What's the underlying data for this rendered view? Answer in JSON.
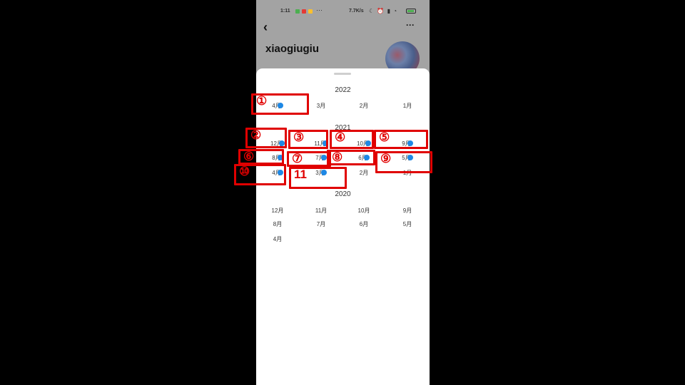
{
  "status_bar": {
    "time": "1:11",
    "dots": "···",
    "net_speed": "7.7K/s",
    "glyphs": "☾ ⏰ ▮ ◔"
  },
  "header": {
    "back_icon": "‹",
    "more_icon": "···",
    "username": "xiaogiugiu"
  },
  "sheet": {
    "groups": [
      {
        "year": "2022",
        "months": [
          "4月",
          "3月",
          "2月",
          "1月"
        ]
      },
      {
        "year": "2021",
        "months": [
          "12月",
          "11月",
          "10月",
          "9月",
          "8月",
          "7月",
          "6月",
          "5月",
          "4月",
          "3月",
          "2月",
          "1月"
        ]
      },
      {
        "year": "2020",
        "months": [
          "12月",
          "11月",
          "10月",
          "9月",
          "8月",
          "7月",
          "6月",
          "5月",
          "4月"
        ]
      }
    ],
    "months_with_posts": [
      "2022-4月",
      "2021-12月",
      "2021-11月",
      "2021-10月",
      "2021-9月",
      "2021-8月",
      "2021-7月",
      "2021-6月",
      "2021-5月",
      "2021-4月",
      "2021-3月"
    ]
  },
  "annotations": [
    "①",
    "②",
    "③",
    "④",
    "⑤",
    "⑥",
    "⑦",
    "⑧",
    "⑨",
    "⑩",
    "11"
  ],
  "colors": {
    "annotation": "#e00000",
    "dot": "#1e88e5"
  }
}
